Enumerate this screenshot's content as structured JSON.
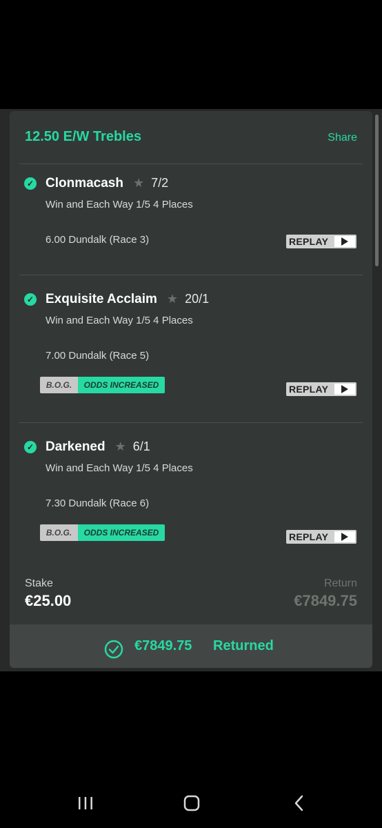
{
  "bet": {
    "title": "12.50 E/W Trebles",
    "share_label": "Share"
  },
  "selections": [
    {
      "horse": "Clonmacash",
      "odds": "7/2",
      "market": "Win and Each Way 1/5 4 Places",
      "race": "6.00 Dundalk (Race 3)",
      "replay_label": "REPLAY",
      "bog": false
    },
    {
      "horse": "Exquisite Acclaim",
      "odds": "20/1",
      "market": "Win and Each Way 1/5 4 Places",
      "race": "7.00 Dundalk (Race 5)",
      "replay_label": "REPLAY",
      "bog": true,
      "bog_label": "B.O.G.",
      "bog_tag": "ODDS INCREASED"
    },
    {
      "horse": "Darkened",
      "odds": "6/1",
      "market": "Win and Each Way 1/5 4 Places",
      "race": "7.30 Dundalk (Race 6)",
      "replay_label": "REPLAY",
      "bog": true,
      "bog_label": "B.O.G.",
      "bog_tag": "ODDS INCREASED"
    }
  ],
  "summary": {
    "stake_label": "Stake",
    "stake_value": "€25.00",
    "return_label": "Return",
    "return_value": "€7849.75"
  },
  "returned": {
    "amount": "€7849.75",
    "label": "Returned"
  },
  "icons": {
    "check": "check-circle-icon",
    "star": "star-icon",
    "play": "play-icon",
    "returned": "check-circle-outline-icon"
  },
  "colors": {
    "accent": "#27d9a2",
    "card": "#333836",
    "background": "#000000"
  }
}
